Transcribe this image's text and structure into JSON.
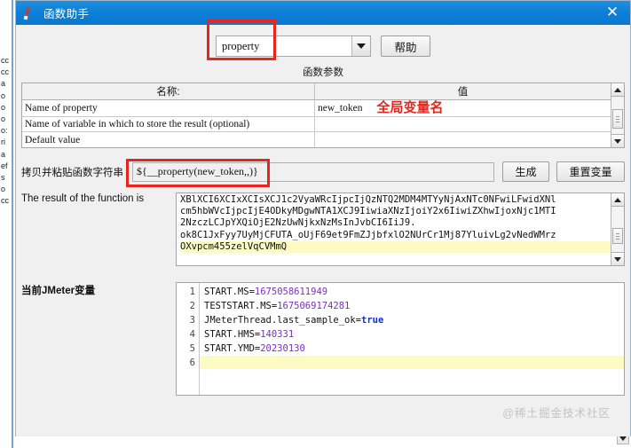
{
  "background_window": {
    "left_strip_lines": [
      "cc",
      "cc",
      "a",
      "o",
      "o",
      "o",
      "o:",
      "ri",
      "a",
      "ef",
      "s",
      "o",
      "cc"
    ]
  },
  "dialog": {
    "title": "函数助手",
    "close_icon": "close-icon",
    "function_select": {
      "value": "property",
      "arrow_icon": "chevron-down-icon"
    },
    "help_button": "帮助",
    "params_section": {
      "title": "函数参数",
      "columns": [
        "名称:",
        "值"
      ],
      "rows": [
        {
          "name": "Name of property",
          "value": "new_token",
          "annotation": "全局变量名"
        },
        {
          "name": "Name of variable in which to store the result (optional)",
          "value": "",
          "annotation": ""
        },
        {
          "name": "Default value",
          "value": "",
          "annotation": ""
        }
      ]
    },
    "function_string": {
      "label": "拷贝并粘贴函数字符串",
      "value": "${__property(new_token,,)}",
      "generate_button": "生成",
      "reset_button": "重置变量"
    },
    "result": {
      "label": "The result of the function is",
      "lines": [
        "XBlXCI6XCIxXCIsXCJ1c2VyaWRcIjpcIjQzNTQ2MDM4MTYyNjAxNTc0NFwiLFwidXNl",
        "cm5hbWVcIjpcIjE4ODkyMDgwNTA1XCJ9IiwiaXNzIjoiY2x6IiwiZXhwIjoxNjc1MTI",
        "2NzczLCJpYXQiOjE2NzUwNjkxNzMsInJvbCI6IiJ9.",
        "ok8C1JxFyy7UyMjCFUTA_oUjF69et9FmZJjbfxlO2NUrCr1Mj87YluivLg2vNedWMrz",
        "OXvpcm455zelVqCVMmQ"
      ],
      "highlight_line_index": 4
    },
    "variables": {
      "label": "当前JMeter变量",
      "line_numbers": [
        "1",
        "2",
        "3",
        "4",
        "5",
        "6"
      ],
      "entries": [
        {
          "key": "START.MS=",
          "value": "1675058611949",
          "value_type": "num"
        },
        {
          "key": "TESTSTART.MS=",
          "value": "1675069174281",
          "value_type": "num"
        },
        {
          "key": "JMeterThread.last_sample_ok=",
          "value": "true",
          "value_type": "bool"
        },
        {
          "key": "START.HMS=",
          "value": "140331",
          "value_type": "num"
        },
        {
          "key": "START.YMD=",
          "value": "20230130",
          "value_type": "num"
        },
        {
          "key": "",
          "value": "",
          "value_type": "empty"
        }
      ]
    }
  },
  "watermark": "@稀土掘金技术社区",
  "colors": {
    "titlebar": "#0d7fd6",
    "annotation_red": "#e8241c",
    "highlight_yellow": "#fcfbc4",
    "number_purple": "#7b2fbe",
    "bool_blue": "#1030d8"
  }
}
